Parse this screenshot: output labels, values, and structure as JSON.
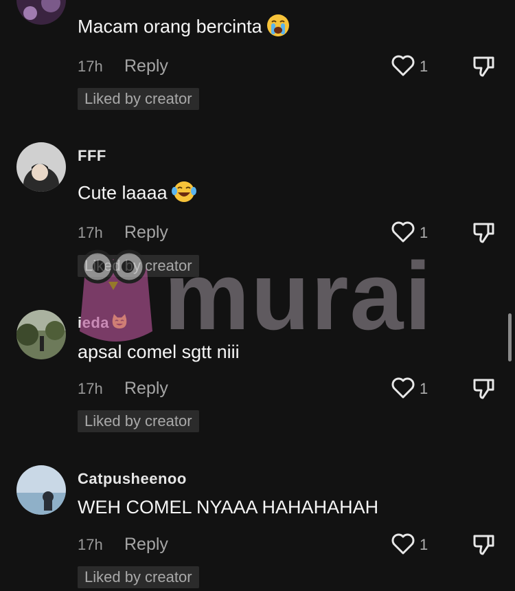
{
  "comments": [
    {
      "username": "",
      "text": "Macam orang bercinta",
      "emoji": "loudly-crying-face-emoji",
      "time": "17h",
      "reply_label": "Reply",
      "likes": "1",
      "badge": "Liked by creator"
    },
    {
      "username": "FFF",
      "text": "Cute laaaa",
      "emoji": "tears-of-joy-face-emoji",
      "time": "17h",
      "reply_label": "Reply",
      "likes": "1",
      "badge": "Liked by creator"
    },
    {
      "username": "ieda",
      "username_emoji": "smiling-cat-emoji",
      "text": "apsal comel sgtt niii",
      "time": "17h",
      "reply_label": "Reply",
      "likes": "1",
      "badge": "Liked by creator"
    },
    {
      "username": "Catpusheenoo",
      "text": "WEH COMEL NYAAA HAHAHAHAH",
      "time": "17h",
      "reply_label": "Reply",
      "likes": "1",
      "badge": "Liked by creator"
    }
  ],
  "watermark": {
    "text": "murai"
  },
  "colors": {
    "background": "#121212",
    "badge_bg": "#2b2b2b",
    "muted_text": "#9a9a9a"
  }
}
